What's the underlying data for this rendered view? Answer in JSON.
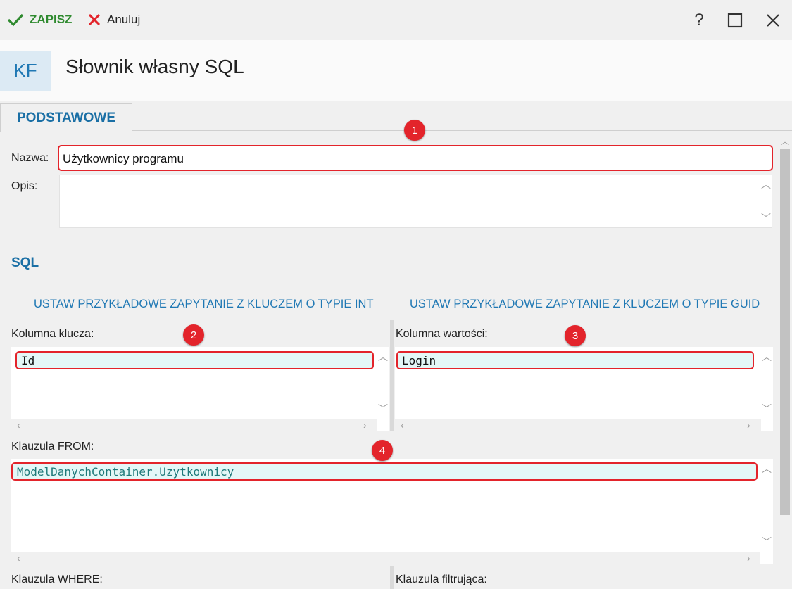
{
  "toolbar": {
    "save_label": "ZAPISZ",
    "cancel_label": "Anuluj",
    "help_label": "?"
  },
  "header": {
    "badge": "KF",
    "title": "Słownik własny SQL"
  },
  "tabs": [
    {
      "label": "PODSTAWOWE"
    }
  ],
  "form": {
    "nazwa_label": "Nazwa:",
    "nazwa_value": "Użytkownicy programu",
    "opis_label": "Opis:",
    "opis_value": ""
  },
  "sql": {
    "title": "SQL",
    "link_int": "USTAW PRZYKŁADOWE ZAPYTANIE Z KLUCZEM O TYPIE INT",
    "link_guid": "USTAW PRZYKŁADOWE ZAPYTANIE Z KLUCZEM O TYPIE GUID",
    "key_label": "Kolumna klucza:",
    "key_value": "Id",
    "value_label": "Kolumna wartości:",
    "value_value": "Login",
    "from_label": "Klauzula FROM:",
    "from_value": "ModelDanychContainer.Uzytkownicy",
    "where_label": "Klauzula WHERE:",
    "filter_label": "Klauzula filtrująca:"
  },
  "annotations": [
    "1",
    "2",
    "3",
    "4"
  ],
  "colors": {
    "accent": "#1a6fa5",
    "highlight": "#e3242b",
    "save": "#2f8a2f"
  }
}
